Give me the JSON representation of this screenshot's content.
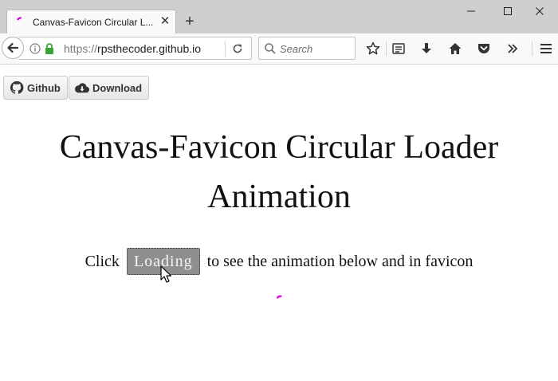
{
  "browser": {
    "tab": {
      "title": "Canvas-Favicon Circular L...",
      "close_glyph": "✕"
    },
    "new_tab_glyph": "+",
    "window_controls": {
      "minimize": "—",
      "maximize": "☐",
      "close": "✕"
    },
    "urlbar": {
      "scheme": "https://",
      "host": "rpsthecoder.github.io"
    },
    "search": {
      "placeholder": "Search"
    },
    "toolbar_icons": [
      "star-icon",
      "reading-list-icon",
      "download-icon",
      "home-icon",
      "pocket-icon",
      "overflow-icon",
      "menu-icon"
    ]
  },
  "page": {
    "buttons": {
      "github_label": "Github",
      "download_label": "Download"
    },
    "heading_line1": "Canvas-Favicon Circular Loader",
    "heading_line2": "Animation",
    "instruction": {
      "before": "Click",
      "button_label": "Loading",
      "after": "to see the animation below and in favicon"
    }
  },
  "colors": {
    "loader_accent": "#e000e0",
    "loading_button_bg": "#8f8f8f",
    "lock_green": "#3aa336"
  }
}
